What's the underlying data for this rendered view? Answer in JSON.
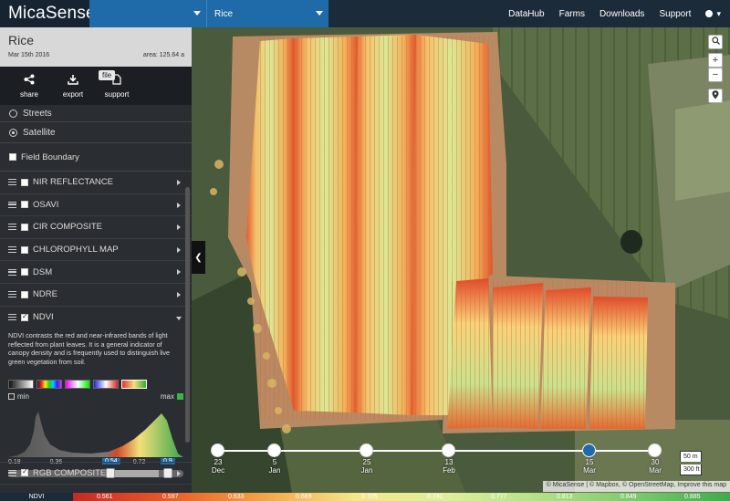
{
  "app": {
    "logo": "MicaSense",
    "field_dropdown": "Rice",
    "nav": [
      "DataHub",
      "Farms",
      "Downloads",
      "Support"
    ]
  },
  "field": {
    "name": "Rice",
    "date": "Mar 15th 2016",
    "area": "area: 125.64 a"
  },
  "actions": {
    "share": "share",
    "export": "export",
    "support": "support",
    "file_tip": "file"
  },
  "basemaps": {
    "streets": "Streets",
    "satellite": "Satellite"
  },
  "field_boundary": "Field Boundary",
  "layers": [
    "NIR REFLECTANCE",
    "OSAVI",
    "CIR COMPOSITE",
    "CHLOROPHYLL MAP",
    "DSM",
    "NDRE",
    "NDVI"
  ],
  "ndvi_description": "NDVI contrasts the red and near-infrared bands of light reflected from plant leaves. It is a general indicator of canopy density and is frequently used to distinguish live green vegetation from soil.",
  "histogram": {
    "min_label": "min",
    "max_label": "max",
    "values": [
      "0.18",
      "0.36",
      "0.54",
      "0.72",
      "0.9"
    ],
    "low_selected": 0.54,
    "high_selected": 0.9
  },
  "rgb_layer": "RGB COMPOSITE",
  "timeline": [
    {
      "day": "23",
      "month": "Dec"
    },
    {
      "day": "5",
      "month": "Jan"
    },
    {
      "day": "25",
      "month": "Jan"
    },
    {
      "day": "13",
      "month": "Feb"
    },
    {
      "day": "15",
      "month": "Mar"
    },
    {
      "day": "30",
      "month": "Mar"
    }
  ],
  "scale": {
    "metric": "50 m",
    "imperial": "300 ft"
  },
  "attribution": "© MicaSense | © Mapbox, © OpenStreetMap, Improve this map",
  "legend": {
    "title": "NDVI",
    "values": [
      "0.561",
      "0.597",
      "0.633",
      "0.669",
      "0.705",
      "0.741",
      "0.777",
      "0.813",
      "0.849",
      "0.885"
    ]
  },
  "colors": {
    "topbar": "#1c2b39",
    "accent": "#1f6aa8",
    "sidebar": "#2a2d31"
  }
}
